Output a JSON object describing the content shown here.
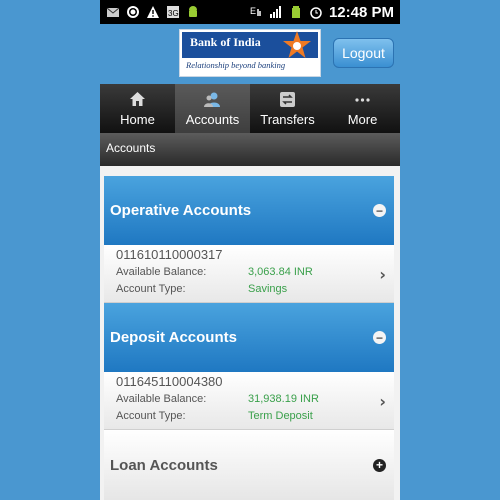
{
  "status_bar": {
    "time": "12:48 PM",
    "icons": [
      "mail-icon",
      "whatsapp-icon",
      "warning-icon",
      "3g-icon",
      "android-icon",
      "edge-signal-icon",
      "signal-icon",
      "battery-icon",
      "alarm-icon"
    ]
  },
  "header": {
    "logo": {
      "name": "Bank of India",
      "tagline": "Relationship beyond banking"
    },
    "logout_label": "Logout"
  },
  "tabs": [
    {
      "label": "Home",
      "icon": "home-icon",
      "active": false
    },
    {
      "label": "Accounts",
      "icon": "user-icon",
      "active": true
    },
    {
      "label": "Transfers",
      "icon": "transfer-icon",
      "active": false
    },
    {
      "label": "More",
      "icon": "more-dots-icon",
      "active": false
    }
  ],
  "section_title": "Accounts",
  "groups": [
    {
      "title": "Operative Accounts",
      "expanded": true,
      "accounts": [
        {
          "number": "011610110000317",
          "balance_label": "Available Balance:",
          "balance": "3,063.84 INR",
          "type_label": "Account Type:",
          "type": "Savings"
        }
      ]
    },
    {
      "title": "Deposit Accounts",
      "expanded": true,
      "accounts": [
        {
          "number": "011645110004380",
          "balance_label": "Available Balance:",
          "balance": "31,938.19 INR",
          "type_label": "Account Type:",
          "type": "Term Deposit"
        }
      ]
    },
    {
      "title": "Loan Accounts",
      "expanded": false,
      "accounts": []
    }
  ],
  "colors": {
    "background": "#4a97d0",
    "group_header": "#2a86cc",
    "value_green": "#3aa04b",
    "tabbar": "#222222"
  }
}
